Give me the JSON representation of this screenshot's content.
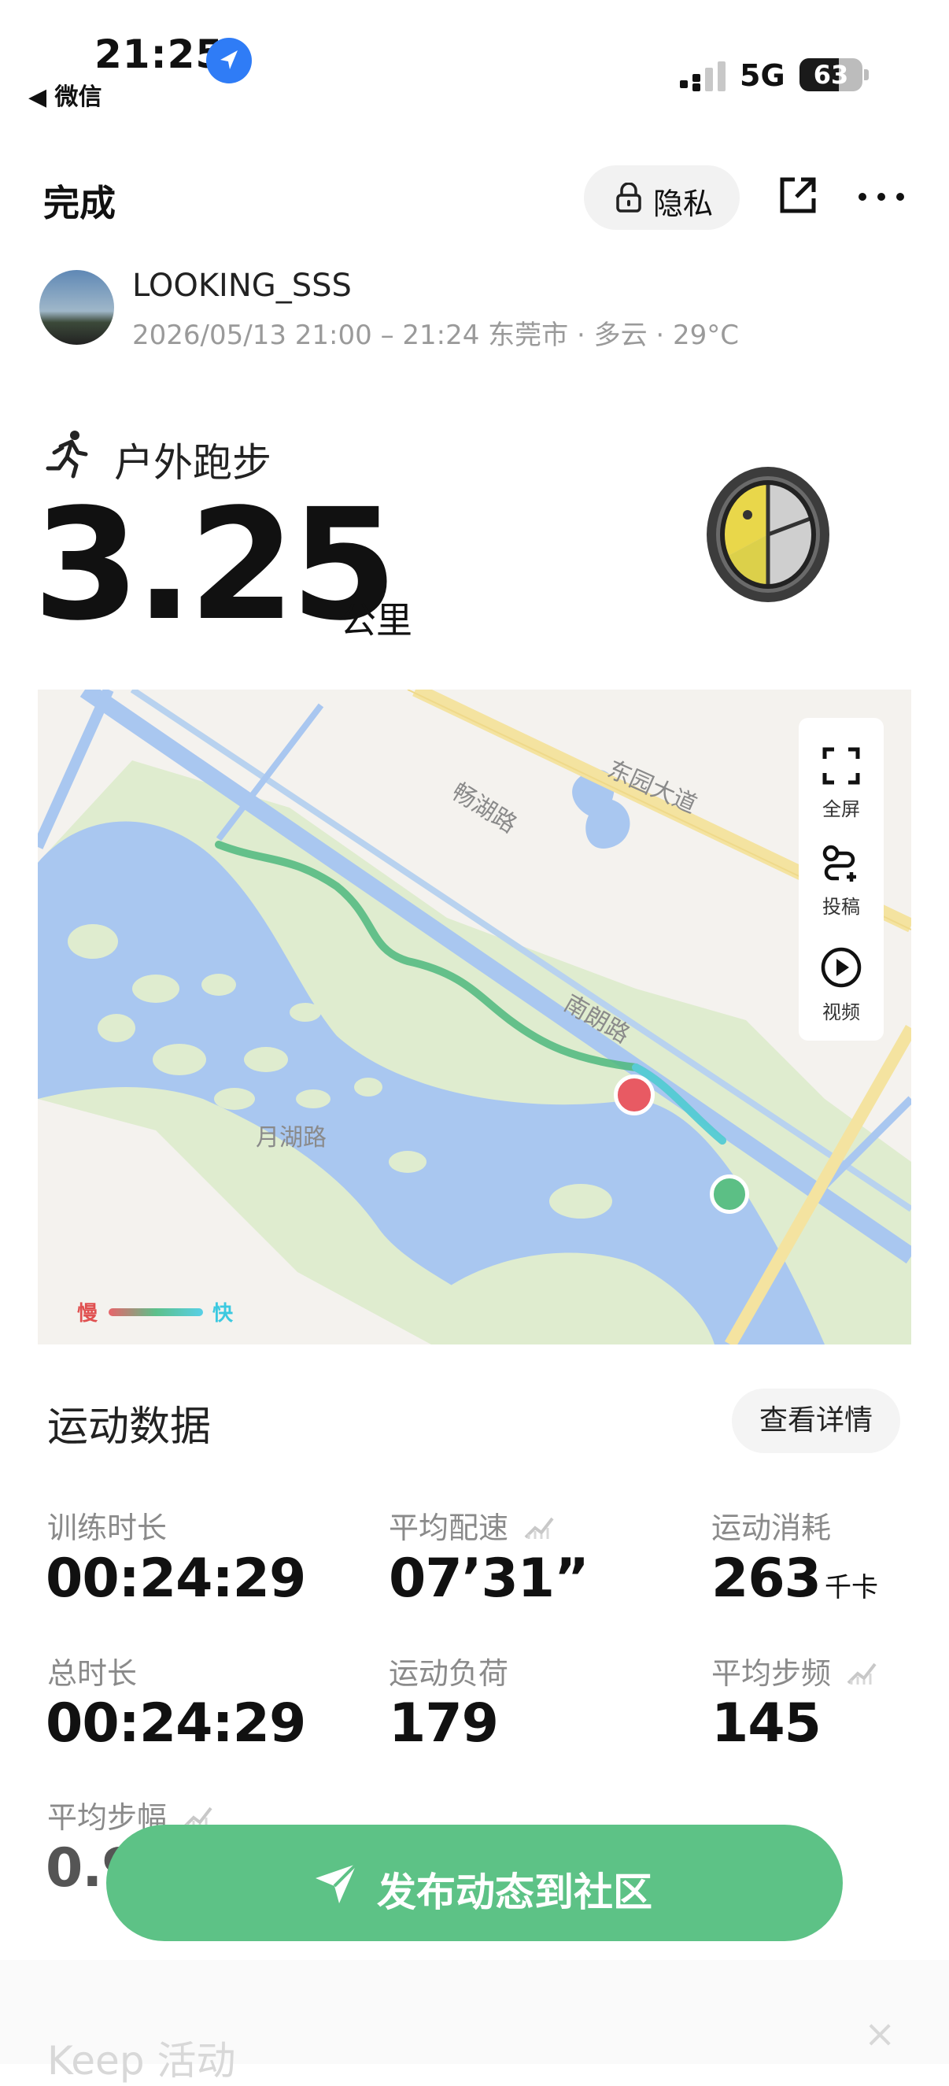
{
  "status_bar": {
    "time": "21:25",
    "back_label": "◀ 微信",
    "network": "5G",
    "battery": "63",
    "battery_level": 63
  },
  "header": {
    "done_label": "完成",
    "privacy_label": "隐私",
    "share_icon": "share-external-icon",
    "more_icon": "more-dots-icon"
  },
  "profile": {
    "username": "LOOKING_SSS",
    "meta": "2026/05/13 21:00 – 21:24 东莞市 · 多云 · 29°C"
  },
  "activity": {
    "type": "户外跑步",
    "distance": "3.25",
    "unit": "公里"
  },
  "map": {
    "roads": [
      "东园大道",
      "畅湖路",
      "南朗路",
      "月湖路"
    ],
    "tools": [
      {
        "label": "全屏",
        "icon": "fullscreen-icon"
      },
      {
        "label": "投稿",
        "icon": "route-submit-icon"
      },
      {
        "label": "视频",
        "icon": "play-video-icon"
      }
    ],
    "legend_slow": "慢",
    "legend_fast": "快",
    "colors": {
      "water": "#a9c7f0",
      "green": "#dfeccf",
      "route": "#5cbf85",
      "start": "#5cbf85",
      "end": "#e85a63"
    }
  },
  "stats": {
    "title": "运动数据",
    "detail_button": "查看详情",
    "items": [
      {
        "label": "训练时长",
        "value": "00:24:29",
        "unit": ""
      },
      {
        "label": "平均配速",
        "value": "07’31”",
        "unit": ""
      },
      {
        "label": "运动消耗",
        "value": "263",
        "unit": "千卡"
      },
      {
        "label": "总时长",
        "value": "00:24:29",
        "unit": ""
      },
      {
        "label": "运动负荷",
        "value": "179",
        "unit": ""
      },
      {
        "label": "平均步频",
        "value": "145",
        "unit": ""
      },
      {
        "label": "平均步幅",
        "value": "0.9",
        "unit": ""
      }
    ]
  },
  "publish_button": "发布动态到社区",
  "bottom": {
    "text": "Keep 活动",
    "close": "×"
  },
  "accent_color": "#5dc286"
}
